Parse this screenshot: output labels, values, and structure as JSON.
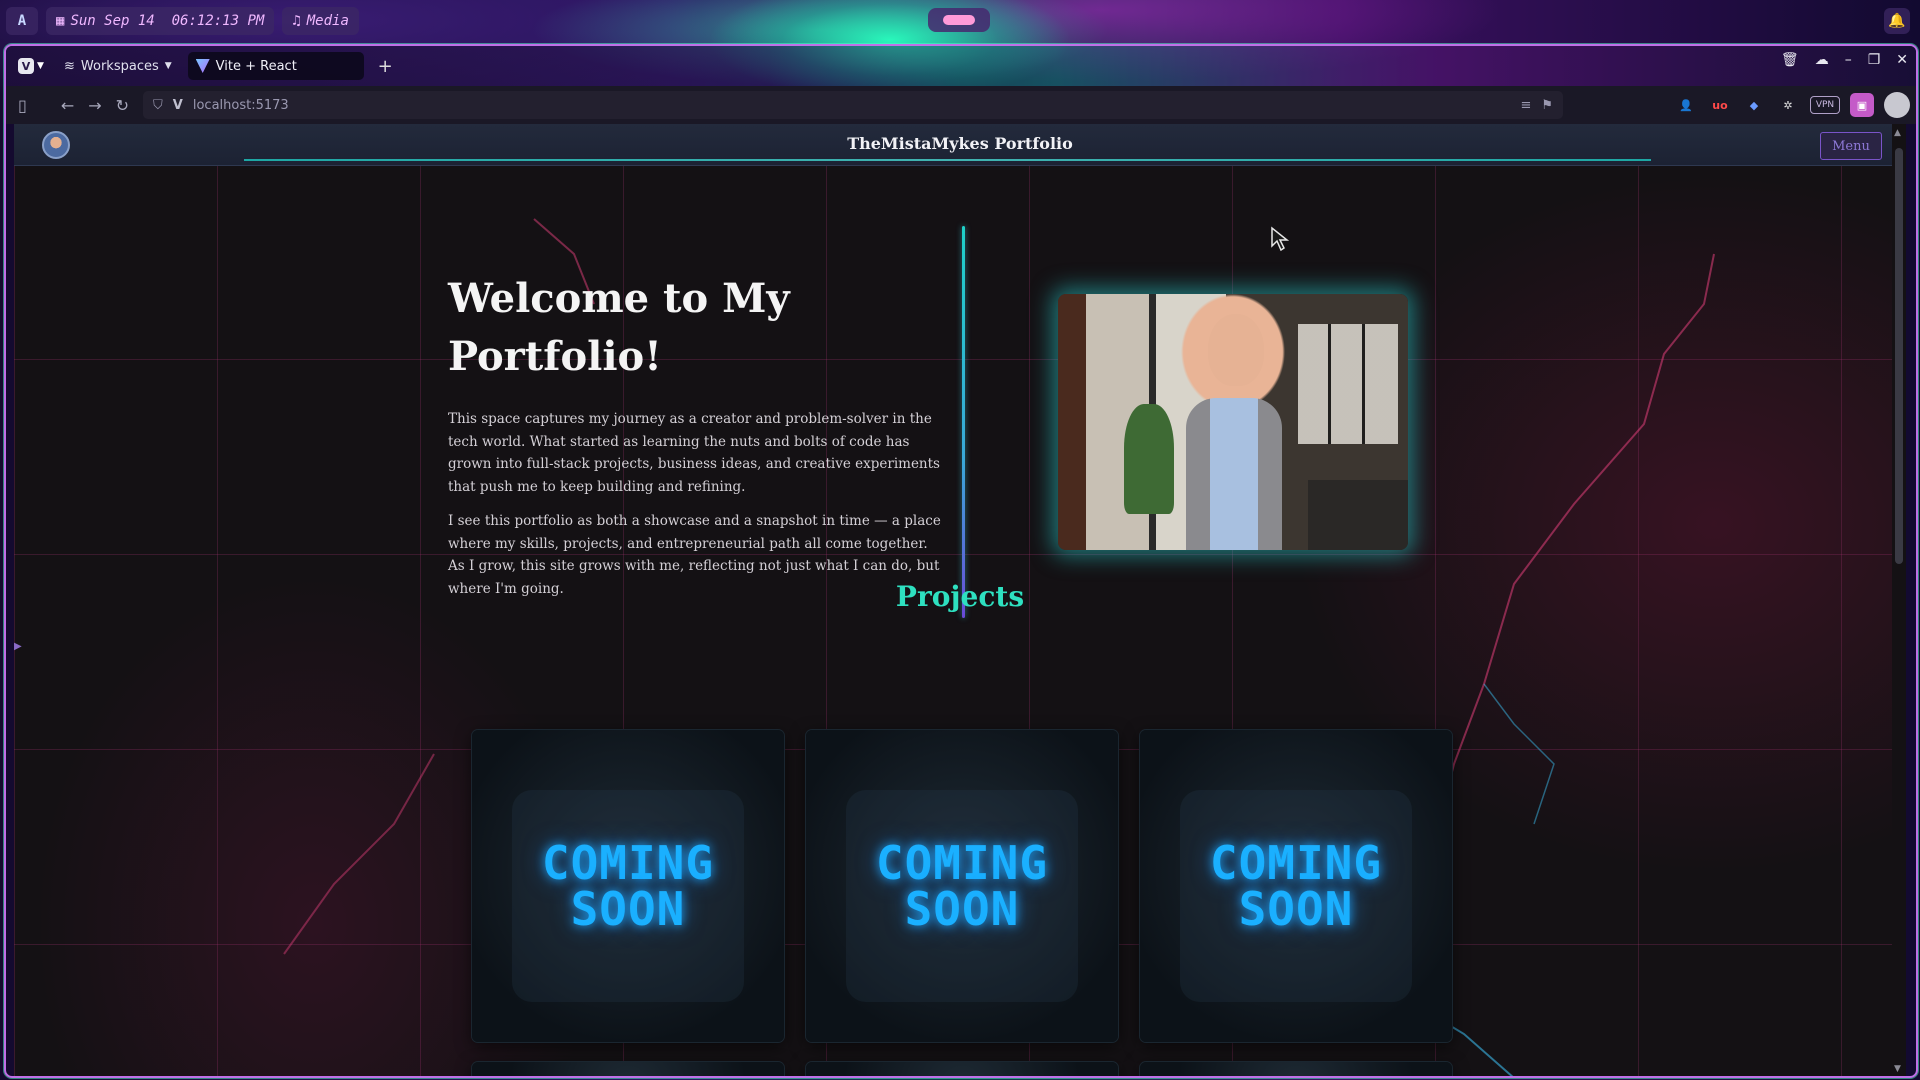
{
  "desktop": {
    "datetime": "Sun Sep 14  06:12:13 PM",
    "media_label": "Media",
    "logo_glyph": "A"
  },
  "browser": {
    "workspaces_label": "Workspaces",
    "tab_title": "Vite + React",
    "url": "localhost:5173",
    "vpn_label": "VPN",
    "ublock_label": "uo"
  },
  "site": {
    "header_title": "TheMistaMykes Portfolio",
    "menu_label": "Menu",
    "intro": {
      "heading": "Welcome to My Portfolio!",
      "paragraph_1": "This space captures my journey as a creator and problem-solver in the tech world. What started as learning the nuts and bolts of code has grown into full-stack projects, business ideas, and creative experiments that push me to keep building and refining.",
      "paragraph_2": "I see this portfolio as both a showcase and a snapshot in time — a place where my skills, projects, and entrepreneurial path all come together. As I grow, this site grows with me, reflecting not just what I can do, but where I'm going."
    },
    "projects": {
      "title": "Projects",
      "cards": [
        {
          "line1": "COMING",
          "line2": "SOON"
        },
        {
          "line1": "COMING",
          "line2": "SOON"
        },
        {
          "line1": "COMING",
          "line2": "SOON"
        }
      ]
    }
  },
  "colors": {
    "accent_teal": "#2ee0c0",
    "coming_soon_blue": "#1ab0ff",
    "menu_purple": "#7a54c8"
  }
}
